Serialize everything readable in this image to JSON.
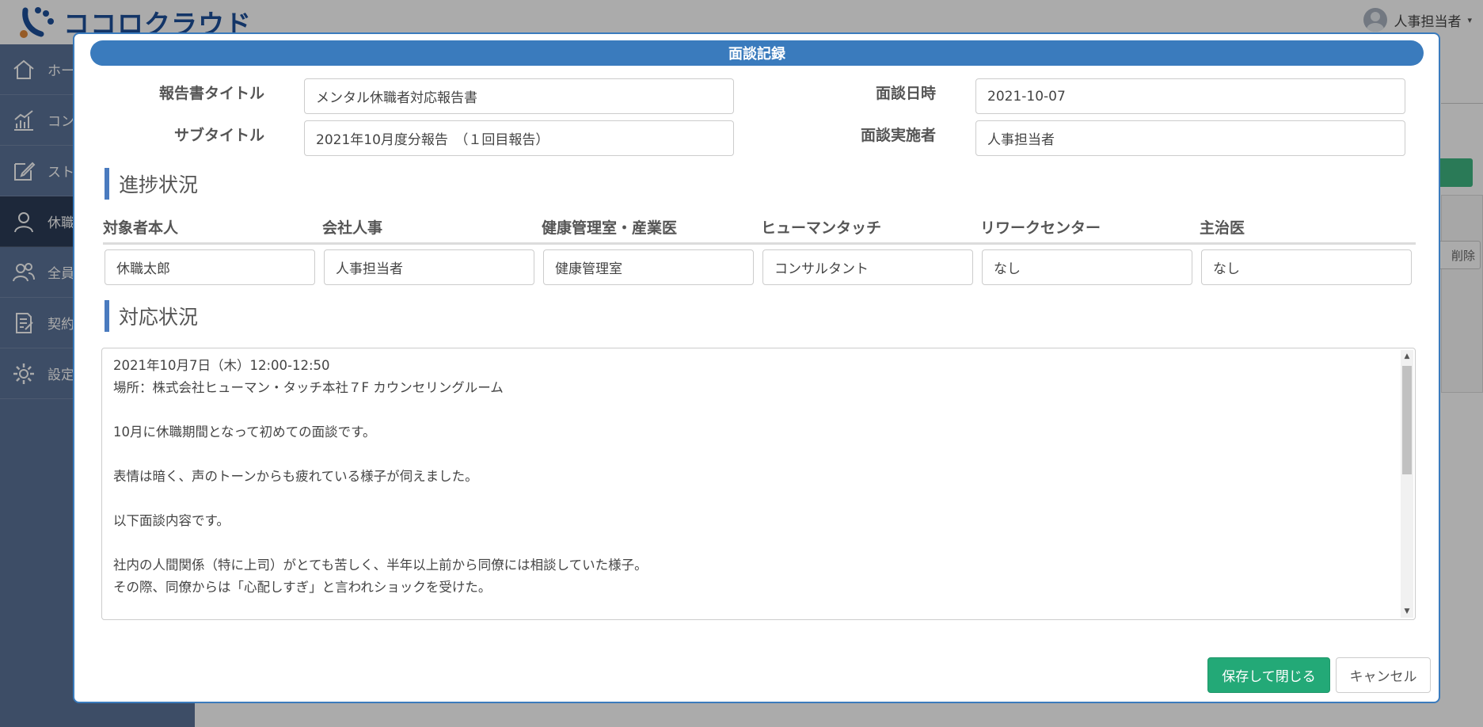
{
  "app": {
    "logo_text": "ココロクラウド",
    "user_name": "人事担当者",
    "caret": "▾"
  },
  "sidebar": {
    "items": [
      {
        "label": "ホー",
        "icon": "home-icon"
      },
      {
        "label": "コン",
        "icon": "chart-icon"
      },
      {
        "label": "スト",
        "icon": "edit-icon"
      },
      {
        "label": "休職",
        "icon": "person-icon",
        "active": true
      },
      {
        "label": "全員",
        "icon": "people-icon"
      },
      {
        "label": "契約",
        "icon": "contract-icon"
      },
      {
        "label": "設定",
        "icon": "gear-icon"
      }
    ]
  },
  "background": {
    "delete_label": "削除"
  },
  "modal": {
    "title": "面談記録",
    "fields": {
      "report_title_label": "報告書タイトル",
      "report_title_value": "メンタル休職者対応報告書",
      "subtitle_label": "サブタイトル",
      "subtitle_value": "2021年10月度分報告　（１回目報告）",
      "interview_date_label": "面談日時",
      "interview_date_value": "2021-10-07",
      "interviewer_label": "面談実施者",
      "interviewer_value": "人事担当者"
    },
    "progress": {
      "title": "進捗状況",
      "columns": [
        {
          "header": "対象者本人",
          "value": "休職太郎"
        },
        {
          "header": "会社人事",
          "value": "人事担当者"
        },
        {
          "header": "健康管理室・産業医",
          "value": "健康管理室"
        },
        {
          "header": "ヒューマンタッチ",
          "value": "コンサルタント"
        },
        {
          "header": "リワークセンター",
          "value": "なし"
        },
        {
          "header": "主治医",
          "value": "なし"
        }
      ]
    },
    "response": {
      "title": "対応状況",
      "lines": [
        "2021年10月7日（木）12:00-12:50",
        "場所：株式会社ヒューマン・タッチ本社７F カウンセリングルーム",
        "",
        "10月に休職期間となって初めての面談です。",
        "",
        "表情は暗く、声のトーンからも疲れている様子が伺えました。",
        "",
        "以下面談内容です。",
        "",
        "社内の人間関係（特に上司）がとても苦しく、半年以上前から同僚には相談していた様子。",
        "その際、同僚からは「心配しすぎ」と言われショックを受けた。"
      ]
    },
    "buttons": {
      "save_label": "保存して閉じる",
      "cancel_label": "キャンセル"
    }
  },
  "colors": {
    "primary": "#3a7bbd",
    "save": "#23a977",
    "sidebar": "#5b7398",
    "sidebar_active": "#2c3d57"
  }
}
